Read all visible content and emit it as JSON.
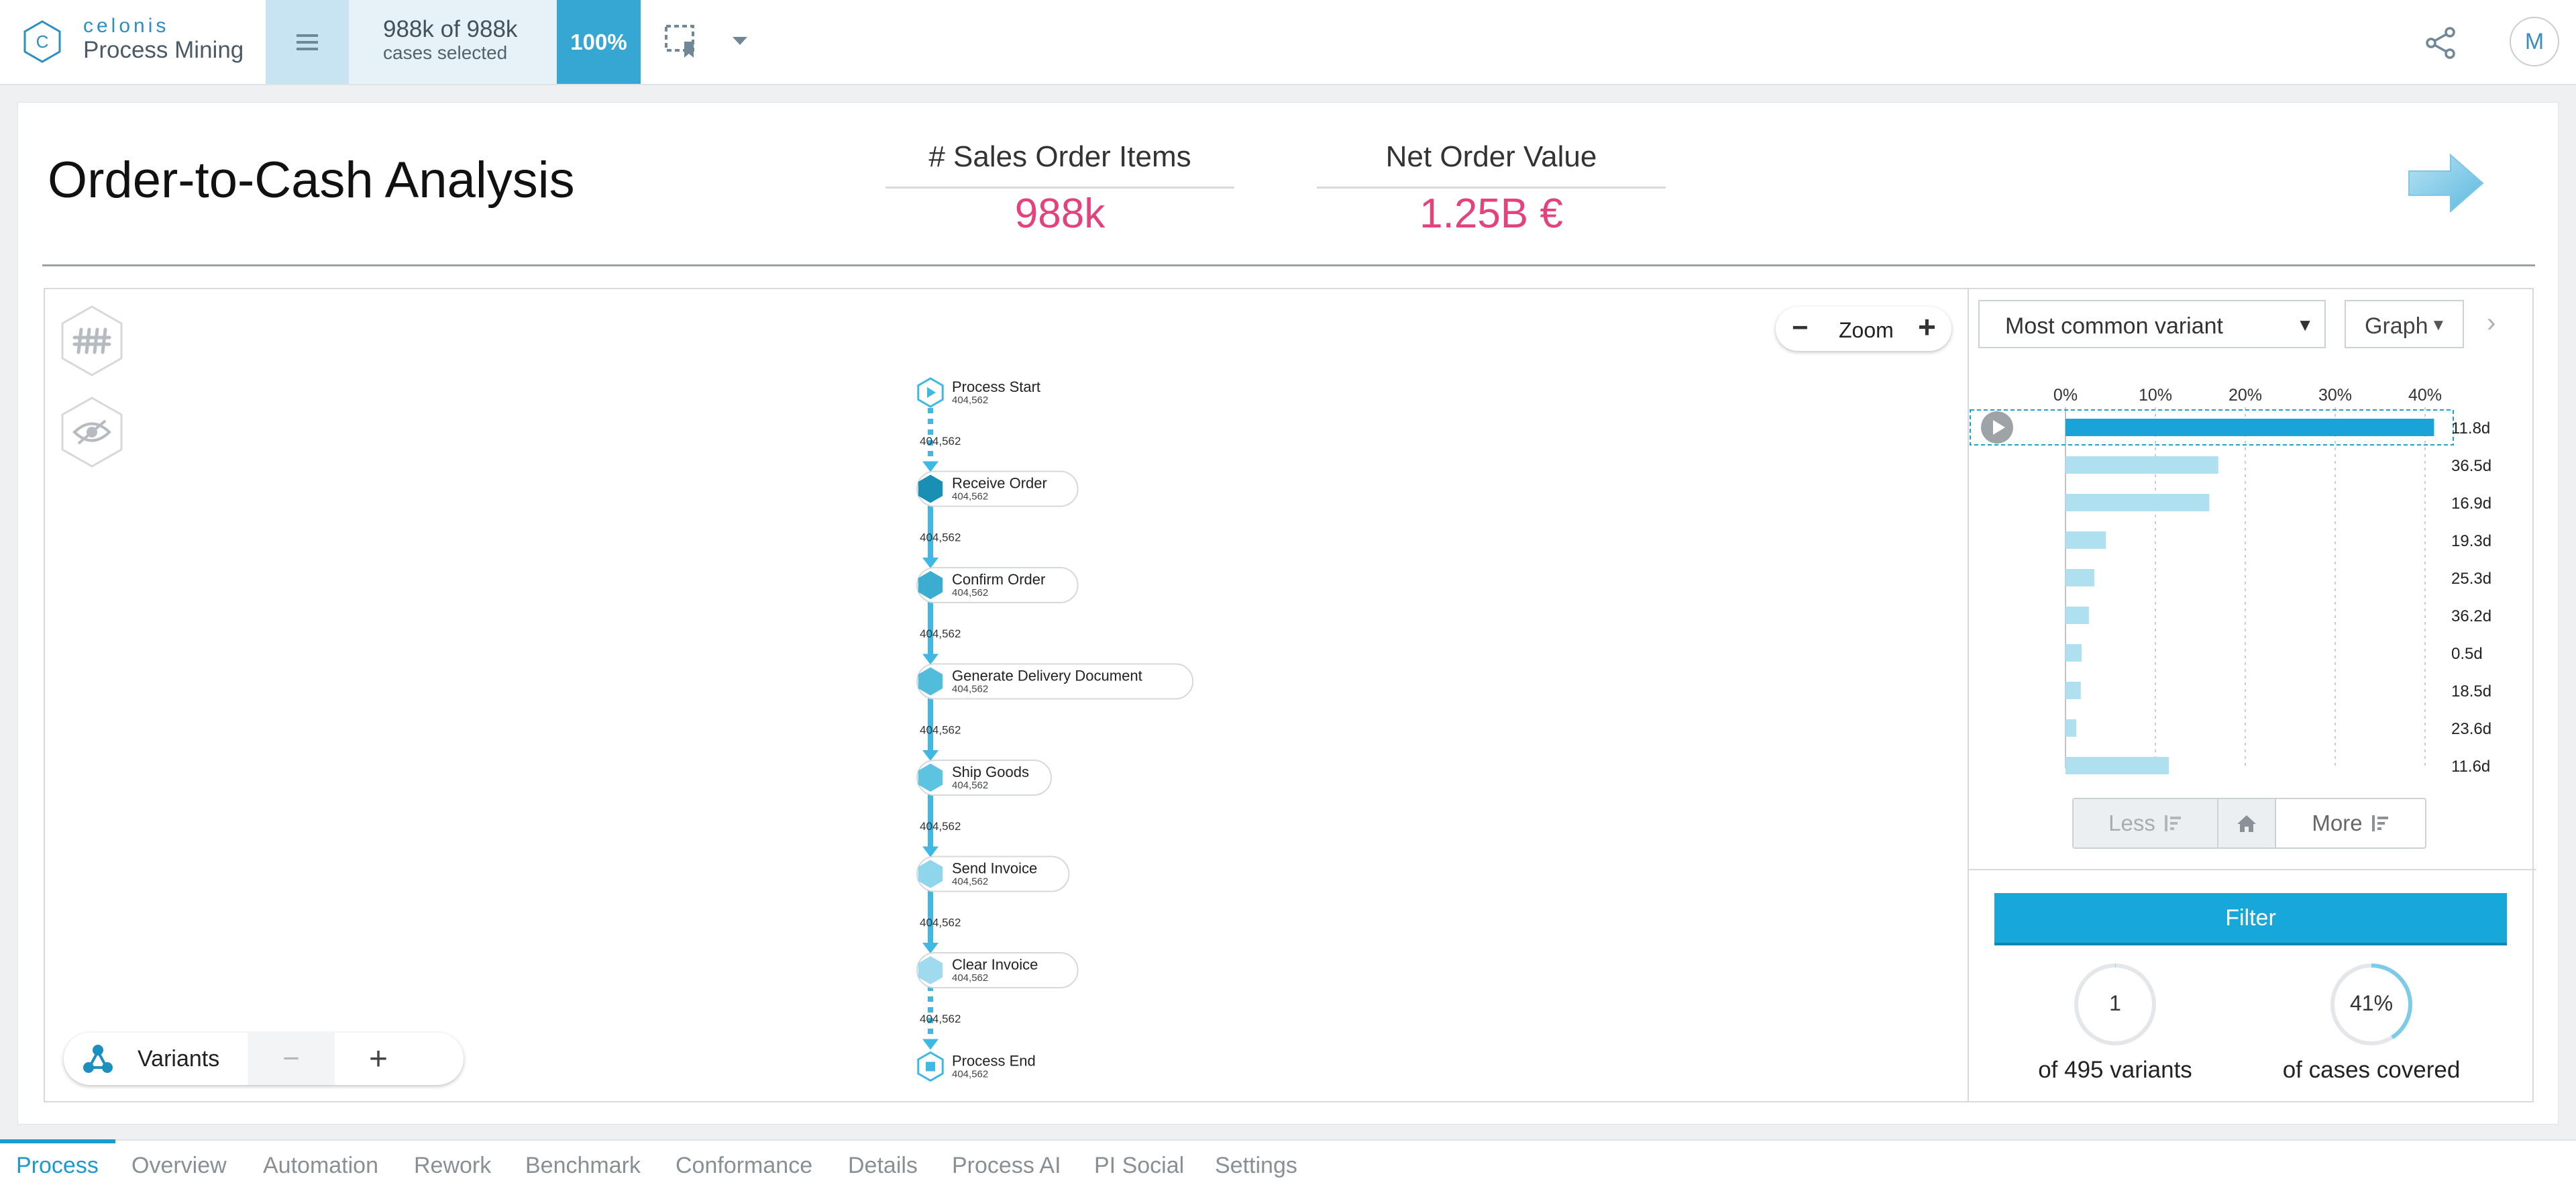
{
  "app": {
    "brand": "celonis",
    "product": "Process Mining"
  },
  "selection": {
    "count": "988k of 988k",
    "sub": "cases selected",
    "percent": "100%"
  },
  "user": {
    "initial": "M"
  },
  "page": {
    "title": "Order-to-Cash Analysis"
  },
  "kpis": [
    {
      "label": "# Sales Order Items",
      "value": "988k"
    },
    {
      "label": "Net Order Value",
      "value": "1.25B €"
    }
  ],
  "zoom": {
    "label": "Zoom",
    "minus": "−",
    "plus": "+"
  },
  "variants_control": {
    "label": "Variants",
    "minus": "−",
    "plus": "+"
  },
  "process_graph": {
    "nodes": [
      {
        "name": "Process Start",
        "count": "404,562",
        "kind": "start"
      },
      {
        "name": "Receive Order",
        "count": "404,562",
        "kind": "activity",
        "shade": "#1a8fb4"
      },
      {
        "name": "Confirm Order",
        "count": "404,562",
        "kind": "activity",
        "shade": "#3aadd1"
      },
      {
        "name": "Generate Delivery Document",
        "count": "404,562",
        "kind": "activity",
        "shade": "#52bcdd"
      },
      {
        "name": "Ship Goods",
        "count": "404,562",
        "kind": "activity",
        "shade": "#5ec2e1"
      },
      {
        "name": "Send Invoice",
        "count": "404,562",
        "kind": "activity",
        "shade": "#8fd5ec"
      },
      {
        "name": "Clear Invoice",
        "count": "404,562",
        "kind": "activity",
        "shade": "#9fdaee"
      },
      {
        "name": "Process End",
        "count": "404,562",
        "kind": "end"
      }
    ],
    "edges": [
      "404,562",
      "404,562",
      "404,562",
      "404,562",
      "404,562",
      "404,562",
      "404,562"
    ]
  },
  "variant_panel": {
    "selector": "Most common variant",
    "view": "Graph",
    "paging": {
      "less": "Less",
      "more": "More"
    },
    "filter_label": "Filter",
    "stats": [
      {
        "value": "1",
        "label": "of 495 variants",
        "fraction": 0.002
      },
      {
        "value": "41%",
        "label": "of cases covered",
        "fraction": 0.41
      }
    ]
  },
  "chart_data": {
    "type": "bar",
    "orientation": "horizontal",
    "x_ticks": [
      "0%",
      "10%",
      "20%",
      "30%",
      "40%"
    ],
    "xlim": [
      0,
      40
    ],
    "series": [
      {
        "values": [
          41,
          17,
          16,
          4.5,
          3.2,
          2.6,
          1.8,
          1.7,
          1.2,
          11.5
        ],
        "durations": [
          "11.8d",
          "36.5d",
          "16.9d",
          "19.3d",
          "25.3d",
          "36.2d",
          "0.5d",
          "18.5d",
          "23.6d",
          "11.6d"
        ]
      }
    ],
    "selected_index": 0,
    "colors": {
      "selected": "#1aa3d6",
      "other": "#aee0f0"
    }
  },
  "tabs": [
    "Process",
    "Overview",
    "Automation",
    "Rework",
    "Benchmark",
    "Conformance",
    "Details",
    "Process AI",
    "PI Social",
    "Settings"
  ],
  "active_tab": "Process"
}
